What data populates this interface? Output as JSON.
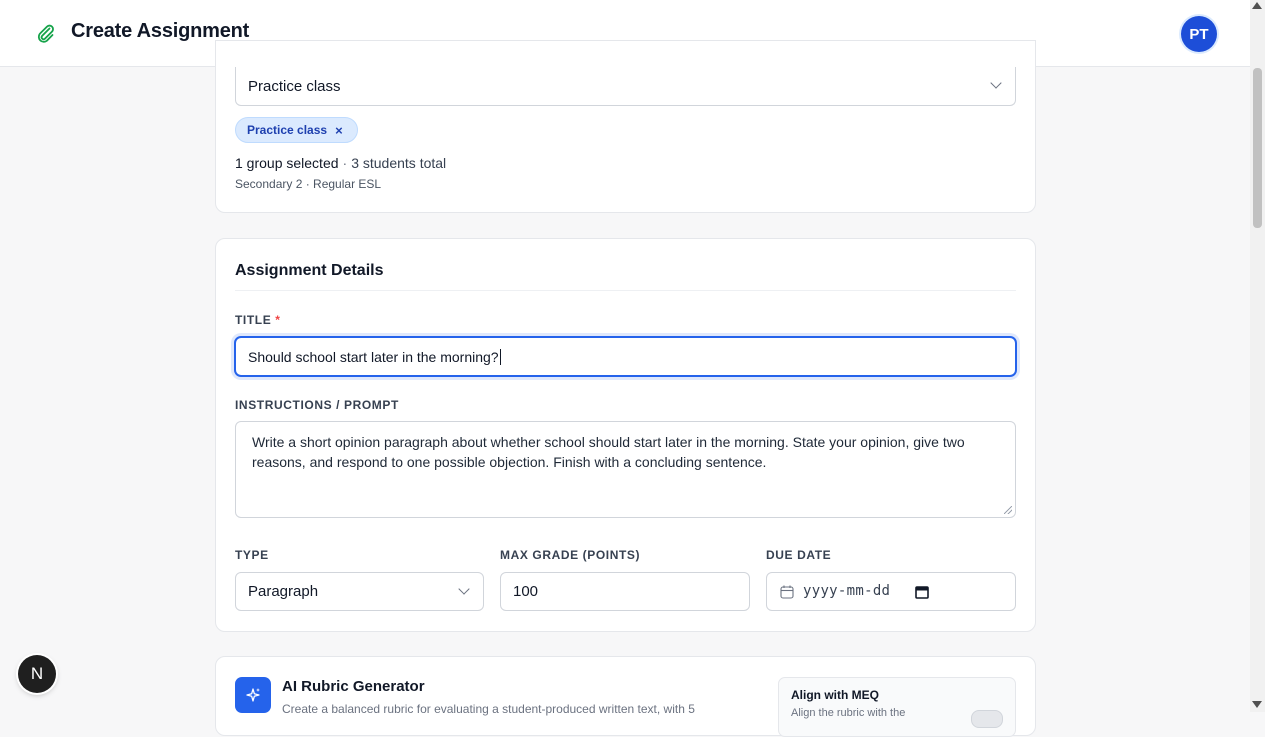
{
  "header": {
    "title": "Create Assignment",
    "avatar_initials": "PT"
  },
  "groups": {
    "select_value": "Practice class",
    "chips": [
      {
        "label": "Practice class",
        "remove": "×"
      }
    ],
    "summary_count": "1 group selected",
    "summary_sep": "·",
    "summary_students": "3 students total",
    "subsummary": "Secondary 2 · Regular ESL"
  },
  "details": {
    "section_title": "Assignment Details",
    "title_label": "TITLE",
    "required_mark": "*",
    "title_value": "Should school start later in the morning?",
    "prompt_label": "INSTRUCTIONS / PROMPT",
    "prompt_value": "Write a short opinion paragraph about whether school should start later in the morning. State your opinion, give two reasons, and respond to one possible objection. Finish with a concluding sentence.",
    "type_label": "TYPE",
    "type_value": "Paragraph",
    "grade_label": "MAX GRADE (POINTS)",
    "grade_value": "100",
    "due_label": "DUE DATE",
    "due_placeholder": "yyyy-mm-dd"
  },
  "rubric": {
    "title": "AI Rubric Generator",
    "description": "Create a balanced rubric for evaluating a student-produced written text, with 5",
    "meq_title": "Align with MEQ",
    "meq_description": "Align the rubric with the"
  },
  "dev_badge": "N",
  "colors": {
    "accent": "#2563eb",
    "avatar": "#1d4ed8",
    "chip_bg": "#dbeafe",
    "required": "#ef4444"
  }
}
